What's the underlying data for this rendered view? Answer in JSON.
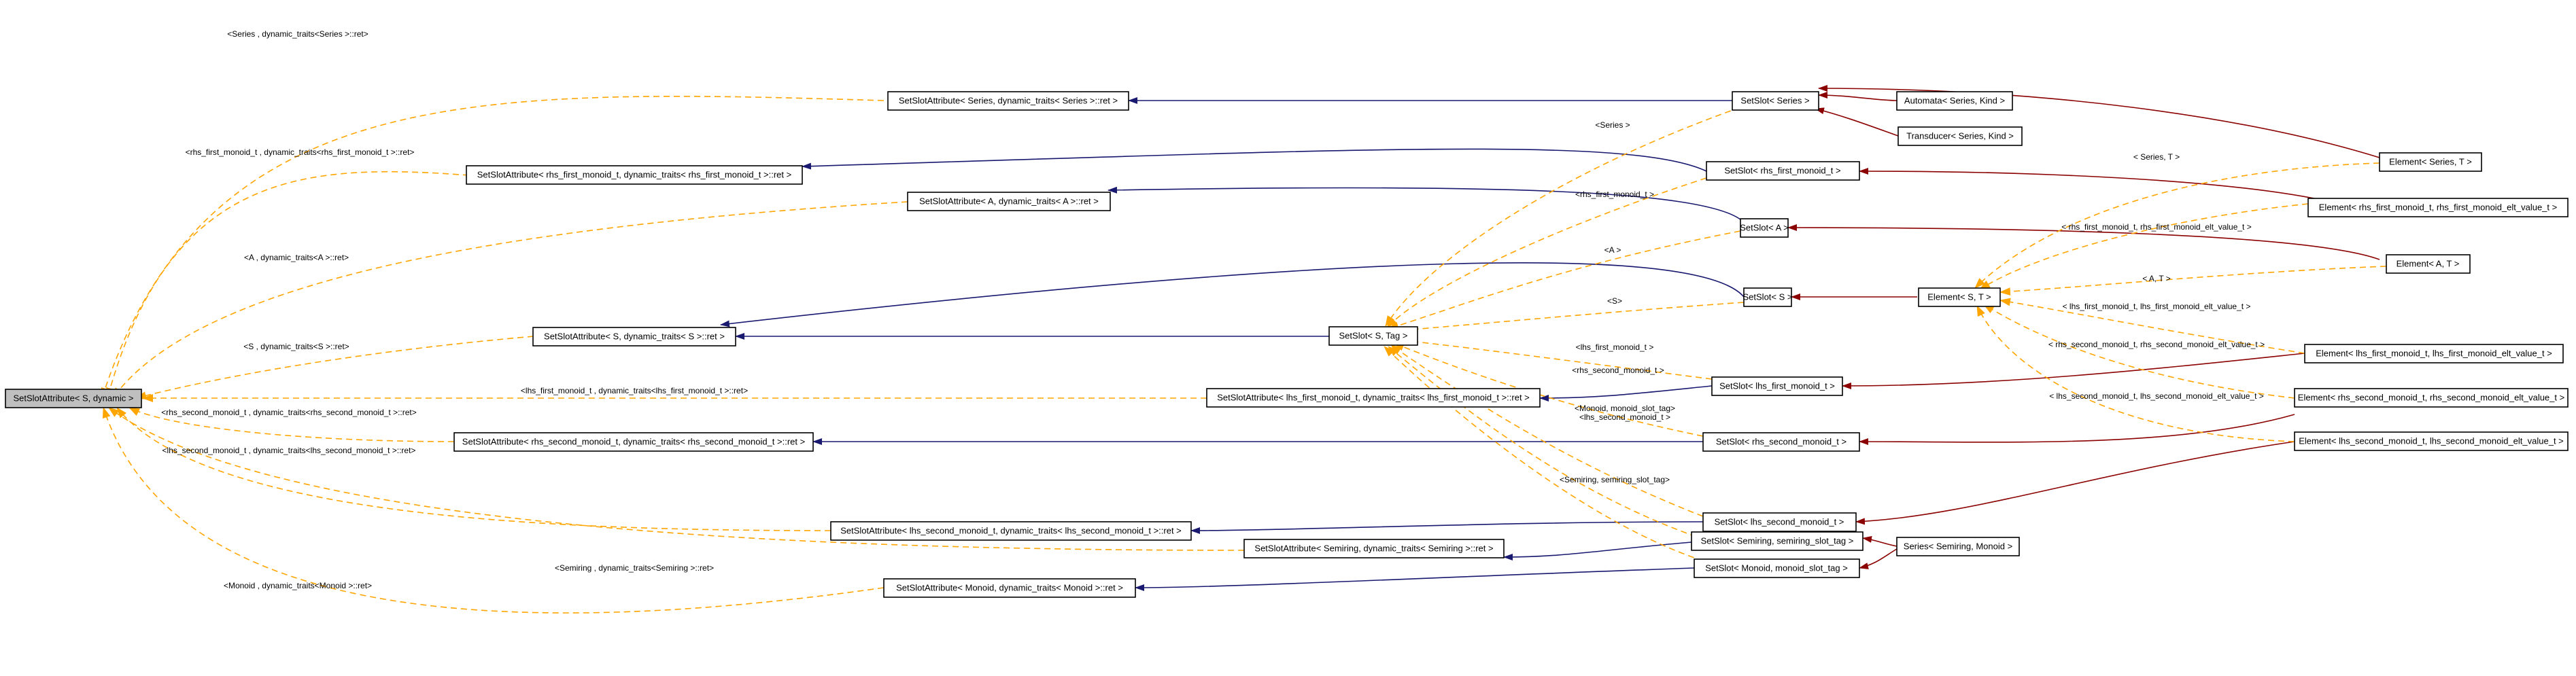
{
  "colors": {
    "navy_edge": "#191970",
    "darkred_edge": "#8b0000",
    "template_edge": "#ffa500",
    "root_fill": "#bfbfbf"
  },
  "nodes": {
    "root": "SetSlotAttribute< S, dynamic >",
    "ssa_series": "SetSlotAttribute< Series, dynamic_traits< Series >::ret >",
    "ssa_rfirst": "SetSlotAttribute< rhs_first_monoid_t, dynamic_traits< rhs_first_monoid_t >::ret >",
    "ssa_a": "SetSlotAttribute< A, dynamic_traits< A >::ret >",
    "ssa_s": "SetSlotAttribute< S, dynamic_traits< S >::ret >",
    "ssa_lfirst": "SetSlotAttribute< lhs_first_monoid_t, dynamic_traits< lhs_first_monoid_t >::ret >",
    "ssa_rsecond": "SetSlotAttribute< rhs_second_monoid_t, dynamic_traits< rhs_second_monoid_t >::ret >",
    "ssa_lsecond": "SetSlotAttribute< lhs_second_monoid_t, dynamic_traits< lhs_second_monoid_t >::ret >",
    "ssa_semiring": "SetSlotAttribute< Semiring, dynamic_traits< Semiring >::ret >",
    "ssa_monoid": "SetSlotAttribute< Monoid, dynamic_traits< Monoid >::ret >",
    "setslot_stag": "SetSlot< S, Tag >",
    "setslot_series": "SetSlot< Series >",
    "setslot_rfirst": "SetSlot< rhs_first_monoid_t >",
    "setslot_a": "SetSlot< A >",
    "setslot_s": "SetSlot< S >",
    "setslot_lfirst": "SetSlot< lhs_first_monoid_t >",
    "setslot_rsecond": "SetSlot< rhs_second_monoid_t >",
    "setslot_lsecond": "SetSlot< lhs_second_monoid_t >",
    "setslot_semiring": "SetSlot< Semiring, semiring_slot_tag >",
    "setslot_monoid": "SetSlot< Monoid, monoid_slot_tag >",
    "automata": "Automata< Series, Kind >",
    "transducer": "Transducer< Series, Kind >",
    "element_st": "Element< S, T >",
    "series_sm": "Series< Semiring, Monoid >",
    "el_series_t": "Element< Series, T >",
    "el_rfirst": "Element< rhs_first_monoid_t, rhs_first_monoid_elt_value_t >",
    "el_a_t": "Element< A, T >",
    "el_lfirst": "Element< lhs_first_monoid_t, lhs_first_monoid_elt_value_t >",
    "el_rsecond": "Element< rhs_second_monoid_t, rhs_second_monoid_elt_value_t >",
    "el_lsecond": "Element< lhs_second_monoid_t, lhs_second_monoid_elt_value_t >"
  },
  "edge_labels": {
    "root_series": "<Series , dynamic_traits<Series >::ret>",
    "root_rfirst": "<rhs_first_monoid_t , dynamic_traits<rhs_first_monoid_t >::ret>",
    "root_a": "<A , dynamic_traits<A >::ret>",
    "root_s": "<S , dynamic_traits<S >::ret>",
    "root_lfirst": "<lhs_first_monoid_t , dynamic_traits<lhs_first_monoid_t >::ret>",
    "root_rsecond": "<rhs_second_monoid_t , dynamic_traits<rhs_second_monoid_t >::ret>",
    "root_lsecond": "<lhs_second_monoid_t , dynamic_traits<lhs_second_monoid_t >::ret>",
    "root_semiring": "<Semiring , dynamic_traits<Semiring >::ret>",
    "root_monoid": "<Monoid , dynamic_traits<Monoid >::ret>",
    "stag_series": "<Series >",
    "stag_rfirst": "<rhs_first_monoid_t >",
    "stag_a": "<A >",
    "stag_s": "<S>",
    "stag_lfirst": "<lhs_first_monoid_t >",
    "stag_rsecond": "<rhs_second_monoid_t >",
    "stag_monoid": "<Monoid, monoid_slot_tag>",
    "stag_lsecond": "<lhs_second_monoid_t >",
    "stag_semiring": "<Semiring, semiring_slot_tag>",
    "est_series": "< Series, T >",
    "est_rfirst": "< rhs_first_monoid_t, rhs_first_monoid_elt_value_t >",
    "est_a": "< A, T >",
    "est_lfirst": "< lhs_first_monoid_t, lhs_first_monoid_elt_value_t >",
    "est_rsecond": "< rhs_second_monoid_t, rhs_second_monoid_elt_value_t >",
    "est_lsecond": "< lhs_second_monoid_t, lhs_second_monoid_elt_value_t >"
  }
}
